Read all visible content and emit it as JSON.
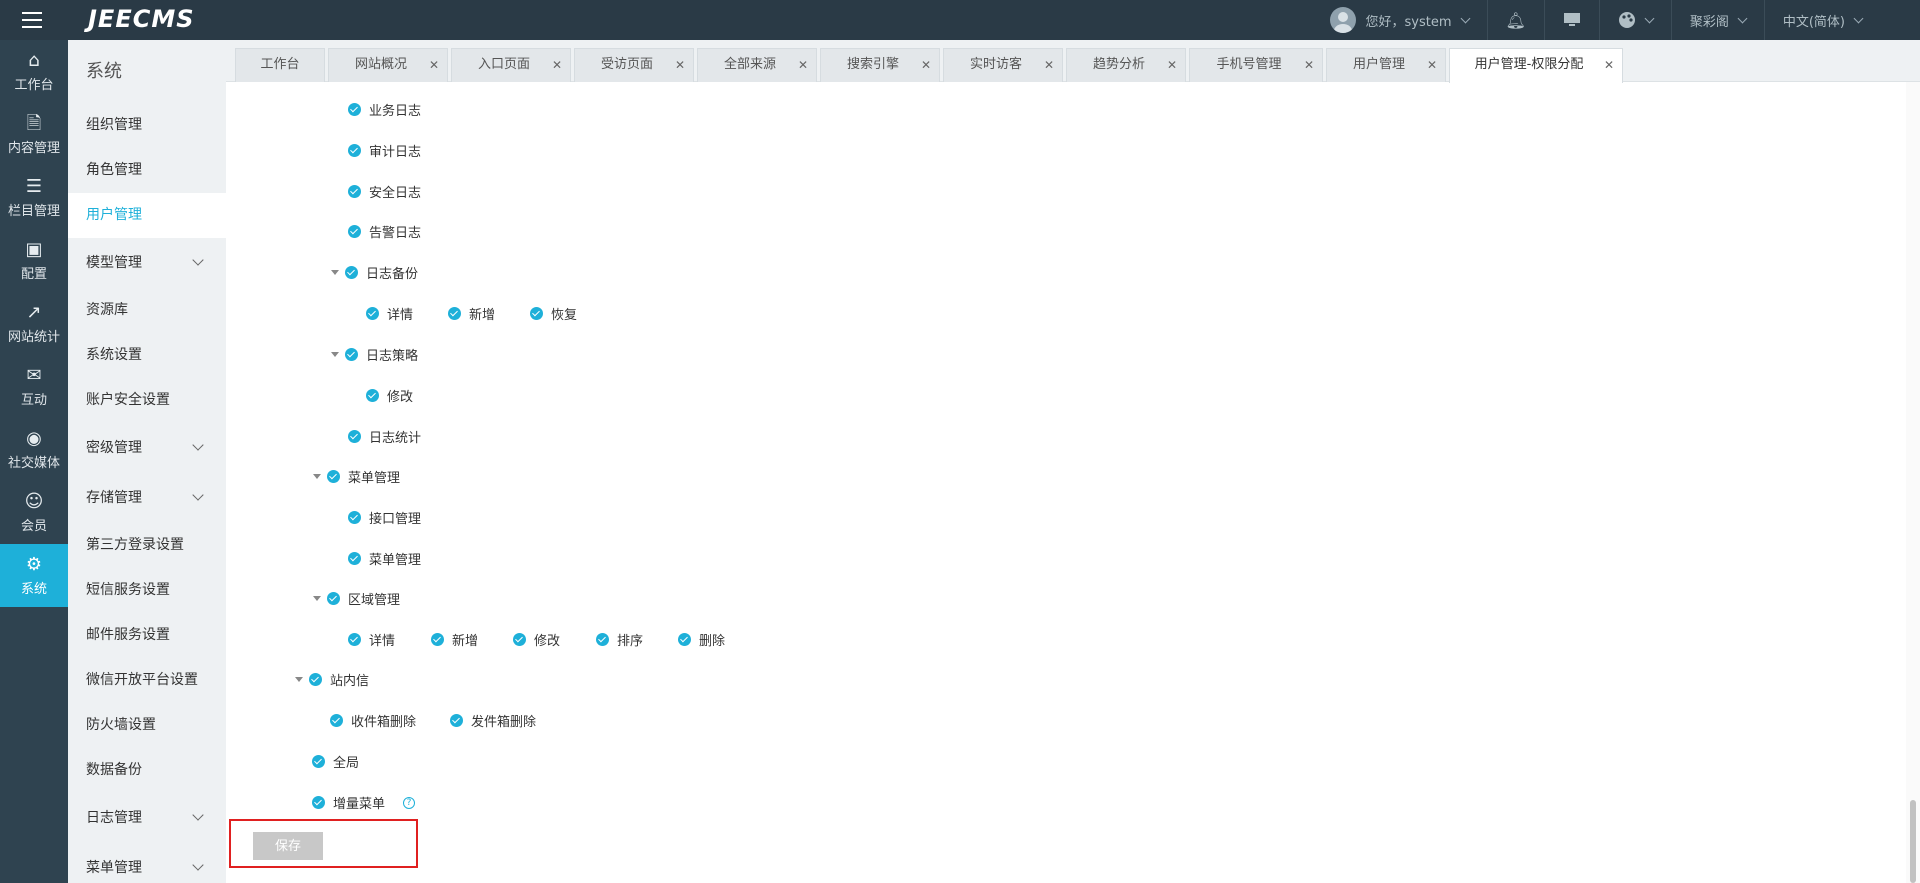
{
  "app": {
    "logo": "JEECMS"
  },
  "topbar": {
    "user_greeting": "您好，system",
    "site_name": "聚彩阁",
    "language": "中文(简体)"
  },
  "rail": [
    {
      "label": "工作台",
      "icon": "home-icon"
    },
    {
      "label": "内容管理",
      "icon": "document-icon"
    },
    {
      "label": "栏目管理",
      "icon": "layers-icon"
    },
    {
      "label": "配置",
      "icon": "box-icon"
    },
    {
      "label": "网站统计",
      "icon": "chart-icon"
    },
    {
      "label": "互动",
      "icon": "chat-icon"
    },
    {
      "label": "社交媒体",
      "icon": "social-icon"
    },
    {
      "label": "会员",
      "icon": "member-icon"
    },
    {
      "label": "系统",
      "icon": "gear-icon"
    }
  ],
  "subnav": {
    "title": "系统",
    "items": [
      {
        "label": "组织管理"
      },
      {
        "label": "角色管理"
      },
      {
        "label": "用户管理"
      },
      {
        "label": "模型管理"
      },
      {
        "label": "资源库"
      },
      {
        "label": "系统设置"
      },
      {
        "label": "账户安全设置"
      },
      {
        "label": "密级管理"
      },
      {
        "label": "存储管理"
      },
      {
        "label": "第三方登录设置"
      },
      {
        "label": "短信服务设置"
      },
      {
        "label": "邮件服务设置"
      },
      {
        "label": "微信开放平台设置"
      },
      {
        "label": "防火墙设置"
      },
      {
        "label": "数据备份"
      },
      {
        "label": "日志管理"
      },
      {
        "label": "菜单管理"
      }
    ]
  },
  "tabs": [
    {
      "label": "工作台"
    },
    {
      "label": "网站概况"
    },
    {
      "label": "入口页面"
    },
    {
      "label": "受访页面"
    },
    {
      "label": "全部来源"
    },
    {
      "label": "搜索引擎"
    },
    {
      "label": "实时访客"
    },
    {
      "label": "趋势分析"
    },
    {
      "label": "手机号管理"
    },
    {
      "label": "用户管理"
    },
    {
      "label": "用户管理-权限分配"
    }
  ],
  "tree": {
    "business_log": "业务日志",
    "audit_log": "审计日志",
    "security_log": "安全日志",
    "alert_log": "告警日志",
    "log_backup": "日志备份",
    "log_backup_detail": "详情",
    "log_backup_add": "新增",
    "log_backup_restore": "恢复",
    "log_policy": "日志策略",
    "log_policy_edit": "修改",
    "log_stats": "日志统计",
    "menu_mgmt": "菜单管理",
    "api_mgmt": "接口管理",
    "menu_mgmt_child": "菜单管理",
    "region_mgmt": "区域管理",
    "region_detail": "详情",
    "region_add": "新增",
    "region_edit": "修改",
    "region_sort": "排序",
    "region_delete": "删除",
    "site_message": "站内信",
    "inbox_delete": "收件箱删除",
    "outbox_delete": "发件箱删除",
    "global": "全局",
    "incremental_menu": "增量菜单"
  },
  "save_label": "保存",
  "colors": {
    "accent": "#1eb0d9",
    "topbar": "#2a3a46",
    "rail": "#2f4350",
    "highlight": "#e02020"
  }
}
